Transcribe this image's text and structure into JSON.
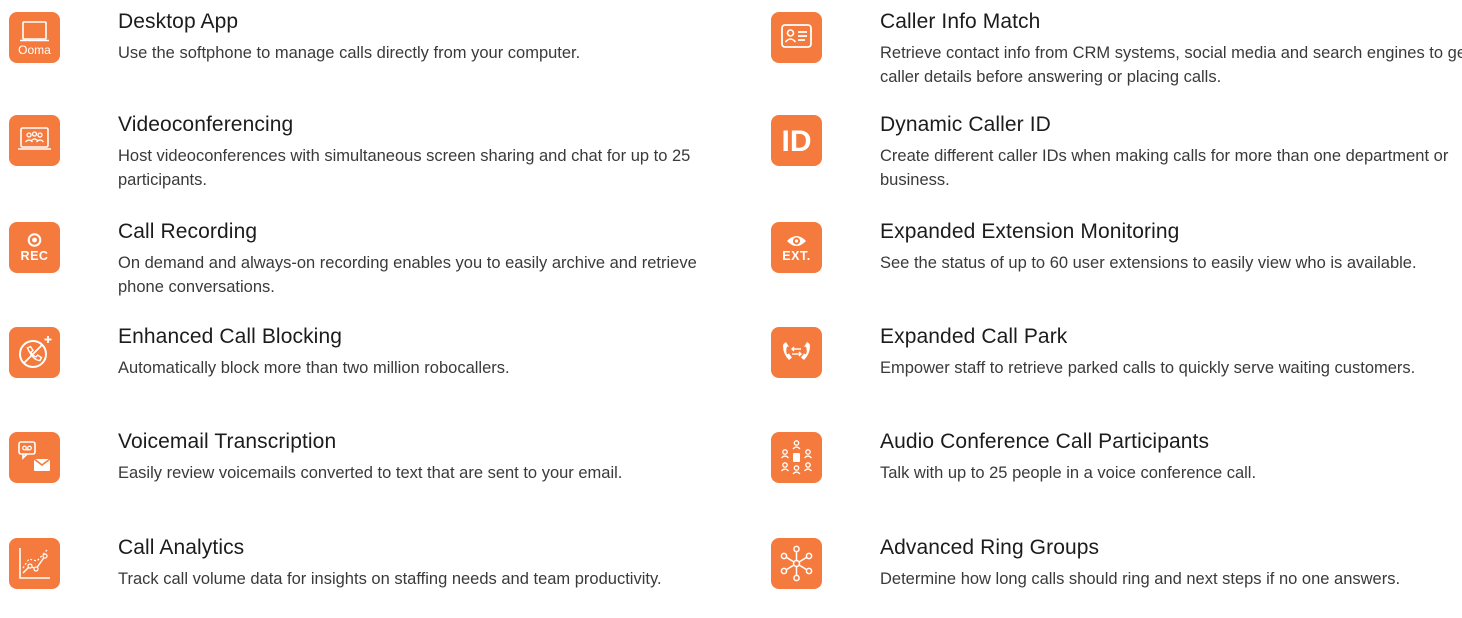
{
  "accent_color": "#f47b3d",
  "left_features": [
    {
      "title": "Desktop App",
      "description": "Use the softphone to manage calls directly from your computer.",
      "icon": "laptop-icon",
      "icon_label": "Ooma"
    },
    {
      "title": "Videoconferencing",
      "description": "Host videoconferences with simultaneous screen sharing and chat for up to 25 participants.",
      "icon": "video-people-icon"
    },
    {
      "title": "Call Recording",
      "description": "On demand and always-on recording enables you to easily archive and retrieve phone conversations.",
      "icon": "record-icon",
      "icon_label": "REC"
    },
    {
      "title": "Enhanced Call Blocking",
      "description": "Automatically block more than two million robocallers.",
      "icon": "blocked-phone-icon"
    },
    {
      "title": "Voicemail Transcription",
      "description": "Easily review voicemails converted to text that are sent to your email.",
      "icon": "voicemail-email-icon"
    },
    {
      "title": "Call Analytics",
      "description": "Track call volume data for insights on staffing needs and team productivity.",
      "icon": "analytics-chart-icon"
    }
  ],
  "right_features": [
    {
      "title": "Caller Info Match",
      "description": "Retrieve contact info from CRM systems, social media and search engines to get caller details before answering or placing calls.",
      "icon": "contact-card-icon"
    },
    {
      "title": "Dynamic Caller ID",
      "description": "Create different caller IDs when making calls for more than one department or business.",
      "icon": "id-icon",
      "icon_label": "ID"
    },
    {
      "title": "Expanded Extension Monitoring",
      "description": "See the status of up to 60 user extensions to easily view who is available.",
      "icon": "eye-extension-icon",
      "icon_label": "EXT."
    },
    {
      "title": "Expanded Call Park",
      "description": "Empower staff to retrieve parked calls to quickly serve waiting customers.",
      "icon": "call-park-icon"
    },
    {
      "title": "Audio Conference Call Participants",
      "description": "Talk with up to 25 people in a voice conference call.",
      "icon": "conference-participants-icon"
    },
    {
      "title": "Advanced Ring Groups",
      "description": "Determine how long calls should ring and next steps if no one answers.",
      "icon": "ring-group-icon"
    }
  ]
}
